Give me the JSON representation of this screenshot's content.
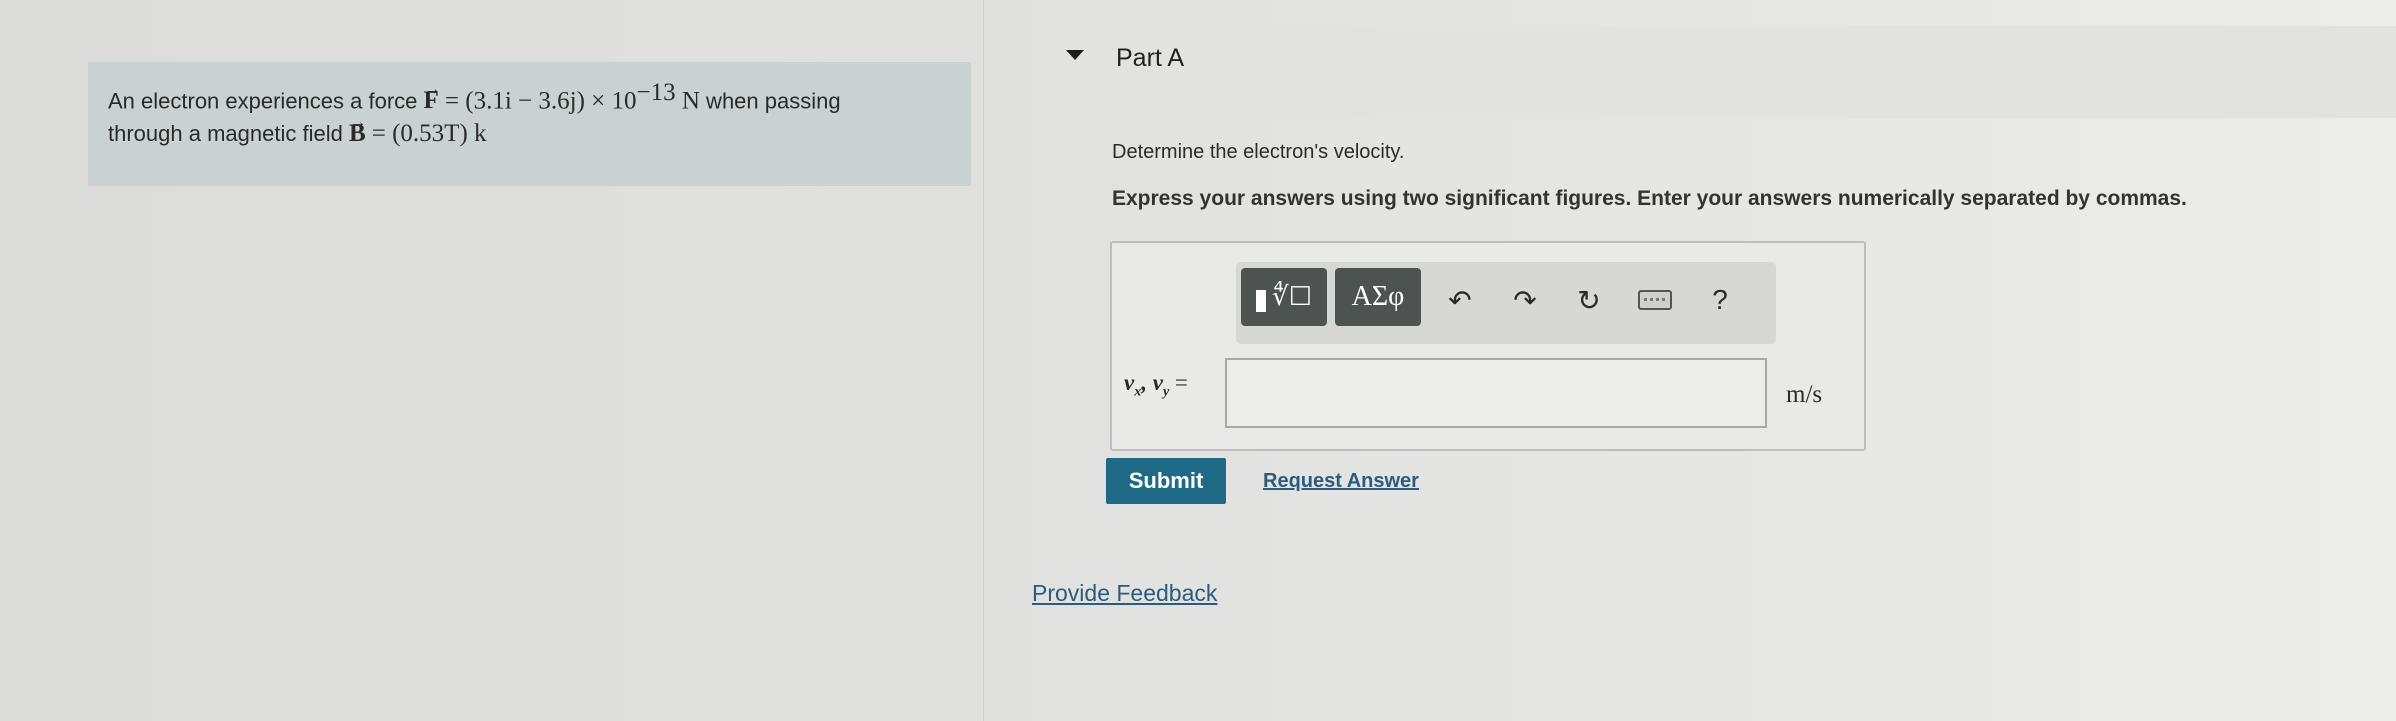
{
  "problem": {
    "line1_prefix": "An electron experiences a force ",
    "force_symbol": "F",
    "force_value_prefix": "= (3.1i − 3.6j) × 10",
    "force_exponent": "−13",
    "force_unit": " N",
    "line1_suffix": " when passing",
    "line2_prefix": "through a magnetic field ",
    "field_symbol": "B",
    "field_value": "= (0.53T) k"
  },
  "part": {
    "title": "Part A",
    "question": "Determine the electron's velocity.",
    "instructions": "Express your answers using two significant figures. Enter your answers numerically separated by commas."
  },
  "toolbar": {
    "template_glyph": "∜☐",
    "greek_label": "ΑΣφ",
    "undo_glyph": "↶",
    "redo_glyph": "↷",
    "reset_glyph": "↻",
    "help_label": "?",
    "icons": [
      "templates-icon",
      "greek-letters-icon",
      "undo-icon",
      "redo-icon",
      "reset-icon",
      "keyboard-icon",
      "help-icon"
    ]
  },
  "answer": {
    "var_x": "x",
    "var_y": "y",
    "var_v": "v",
    "equals": "=",
    "value": "",
    "unit": "m/s"
  },
  "buttons": {
    "submit_label": "Submit",
    "request_answer_label": "Request Answer",
    "provide_feedback_label": "Provide Feedback"
  },
  "colors": {
    "submit_bg": "#1f6a87",
    "link": "#2b5b7e",
    "problem_bg": "#c9d2d0",
    "toolbar_dark": "#4d5350"
  }
}
